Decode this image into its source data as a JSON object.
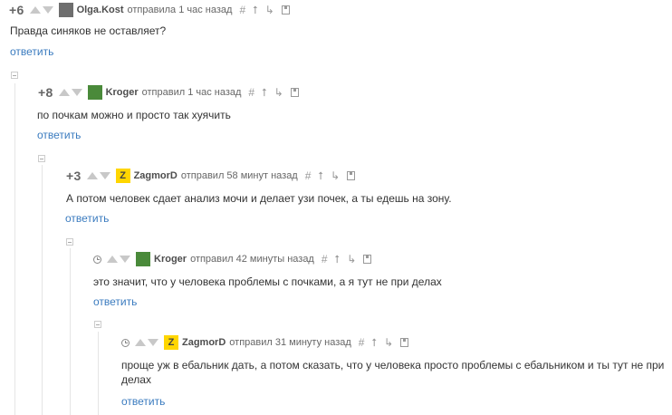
{
  "comments": [
    {
      "rating": "+6",
      "author": "Olga.Kost",
      "meta": "отправила 1 час назад",
      "text": "Правда синяков не оставляет?",
      "reply": "ответить"
    },
    {
      "rating": "+8",
      "author": "Kroger",
      "meta": "отправил 1 час назад",
      "text": "по почкам можно и просто так хуячить",
      "reply": "ответить"
    },
    {
      "rating": "+3",
      "author": "ZagmorD",
      "avatar_letter": "Z",
      "meta": "отправил 58 минут назад",
      "text": "А потом человек сдает анализ мочи и делает узи почек, а ты едешь на зону.",
      "reply": "ответить"
    },
    {
      "author": "Kroger",
      "meta": "отправил 42 минуты назад",
      "text": "это значит, что у человека проблемы с почками, а я тут не при делах",
      "reply": "ответить"
    },
    {
      "author": "ZagmorD",
      "avatar_letter": "Z",
      "meta": "отправил 31 минуту назад",
      "text": "проще уж в ебальник дать, а потом сказать, что у человека просто проблемы с ебальником и ты тут не при делах",
      "reply": "ответить"
    }
  ],
  "icons": {
    "link": "#",
    "parent": "⭡",
    "branch": "↳"
  }
}
